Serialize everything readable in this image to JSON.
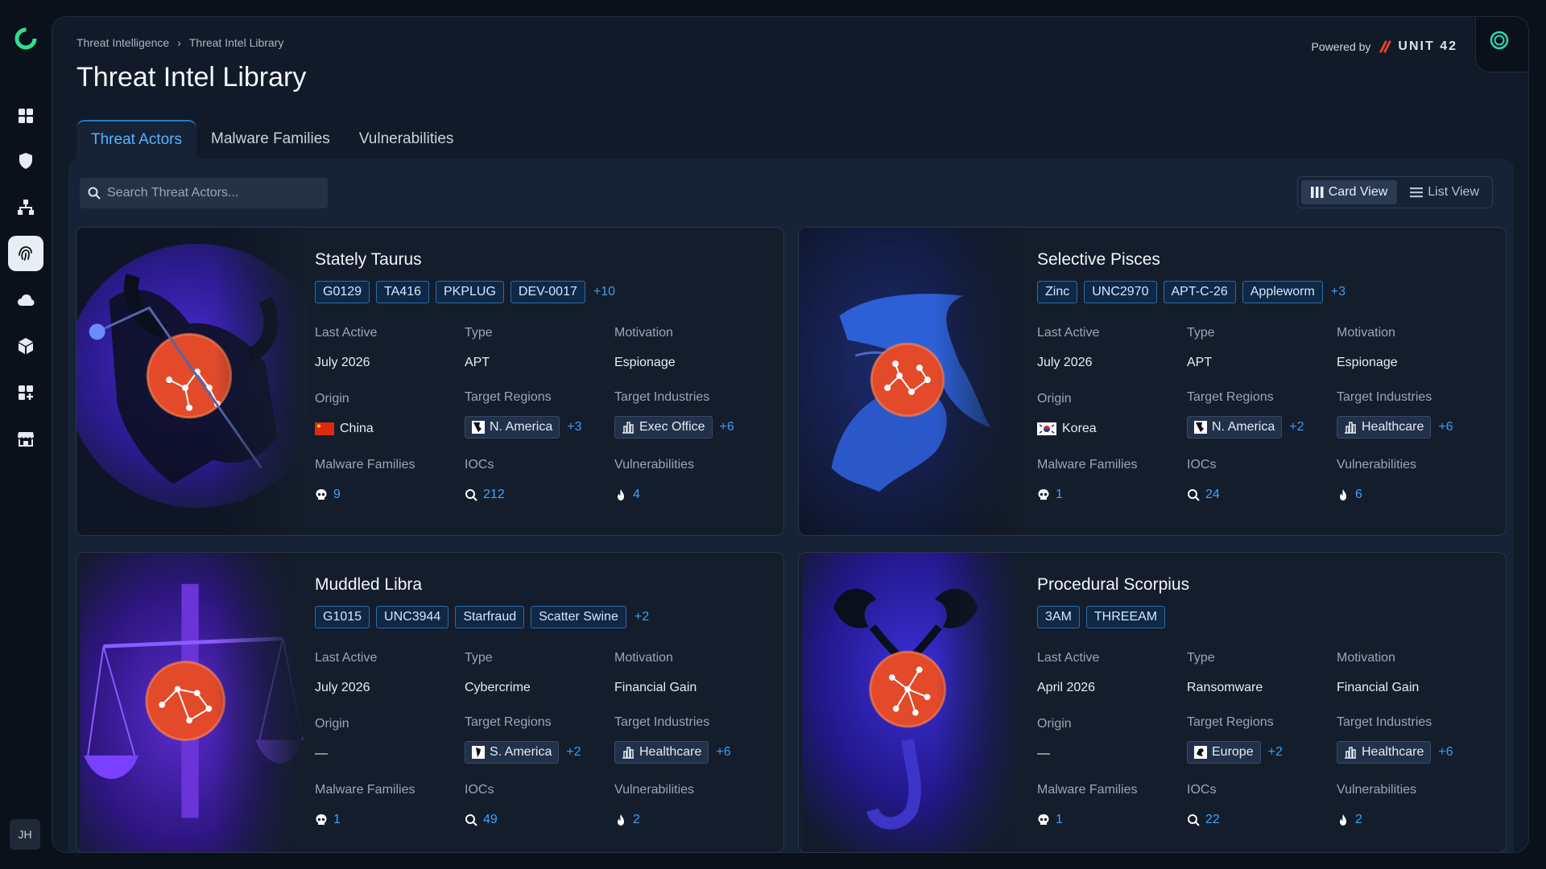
{
  "breadcrumb": [
    "Threat Intelligence",
    "Threat Intel Library"
  ],
  "breadcrumb_sep": "›",
  "page_title": "Threat Intel Library",
  "powered_by": "Powered by",
  "brand": "UNIT 42",
  "user_initials": "JH",
  "tabs": [
    {
      "label": "Threat Actors",
      "active": true
    },
    {
      "label": "Malware Families",
      "active": false
    },
    {
      "label": "Vulnerabilities",
      "active": false
    }
  ],
  "search": {
    "placeholder": "Search Threat Actors..."
  },
  "views": {
    "card": "Card View",
    "list": "List View"
  },
  "labels": {
    "last_active": "Last Active",
    "type": "Type",
    "motivation": "Motivation",
    "origin": "Origin",
    "target_regions": "Target Regions",
    "target_industries": "Target Industries",
    "malware_families": "Malware Families",
    "iocs": "IOCs",
    "vulnerabilities": "Vulnerabilities"
  },
  "actors": [
    {
      "name": "Stately Taurus",
      "aliases": [
        "G0129",
        "TA416",
        "PKPLUG",
        "DEV-0017"
      ],
      "aliases_more": "+10",
      "last_active": "July 2026",
      "type": "APT",
      "motivation": "Espionage",
      "origin": "China",
      "origin_flag": "china",
      "region": "N. America",
      "region_more": "+3",
      "industry": "Exec Office",
      "industry_more": "+6",
      "malware": "9",
      "iocs": "212",
      "vulns": "4"
    },
    {
      "name": "Selective Pisces",
      "aliases": [
        "Zinc",
        "UNC2970",
        "APT-C-26",
        "Appleworm"
      ],
      "aliases_more": "+3",
      "last_active": "July 2026",
      "type": "APT",
      "motivation": "Espionage",
      "origin": "Korea",
      "origin_flag": "korea",
      "region": "N. America",
      "region_more": "+2",
      "industry": "Healthcare",
      "industry_more": "+6",
      "malware": "1",
      "iocs": "24",
      "vulns": "6"
    },
    {
      "name": "Muddled Libra",
      "aliases": [
        "G1015",
        "UNC3944",
        "Starfraud",
        "Scatter Swine"
      ],
      "aliases_more": "+2",
      "last_active": "July 2026",
      "type": "Cybercrime",
      "motivation": "Financial Gain",
      "origin": "—",
      "origin_flag": "",
      "region": "S. America",
      "region_more": "+2",
      "industry": "Healthcare",
      "industry_more": "+6",
      "malware": "1",
      "iocs": "49",
      "vulns": "2"
    },
    {
      "name": "Procedural Scorpius",
      "aliases": [
        "3AM",
        "THREEAM"
      ],
      "aliases_more": "",
      "last_active": "April 2026",
      "type": "Ransomware",
      "motivation": "Financial Gain",
      "origin": "—",
      "origin_flag": "",
      "region": "Europe",
      "region_more": "+2",
      "industry": "Healthcare",
      "industry_more": "+6",
      "malware": "1",
      "iocs": "22",
      "vulns": "2"
    }
  ],
  "colors": {
    "accent": "#3ea4ff",
    "alias_border": "#2e6aa6",
    "brand_red": "#e8412c"
  }
}
